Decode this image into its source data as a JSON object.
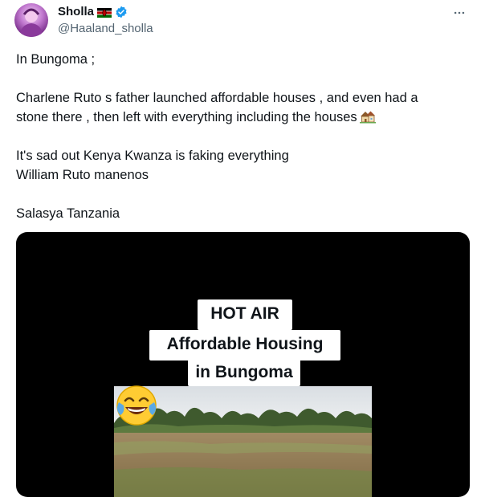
{
  "author": {
    "display_name": "Sholla",
    "handle": "@Haaland_sholla"
  },
  "icons": {
    "flag": "kenya-flag-icon",
    "verified": "verified-badge-icon",
    "more": "more-options-icon",
    "house": "houses-emoji-icon",
    "laugh": "tears-of-joy-emoji-icon"
  },
  "colors": {
    "verified": "#1d9bf0",
    "handle": "#536471",
    "media_background": "#000000"
  },
  "tweet": {
    "paragraphs": [
      {
        "lines": [
          "In Bungoma ;"
        ]
      },
      {
        "lines": [
          "Charlene Ruto s father launched affordable houses , and even had a",
          "stone there , then left  with everything including the houses"
        ]
      },
      {
        "lines": [
          "It's sad out Kenya Kwanza is faking everything",
          "William Ruto manenos"
        ]
      },
      {
        "lines": [
          "Salasya Tanzania"
        ]
      }
    ]
  },
  "media": {
    "caption": [
      "HOT AIR",
      "Affordable Housing",
      "in Bungoma"
    ]
  }
}
